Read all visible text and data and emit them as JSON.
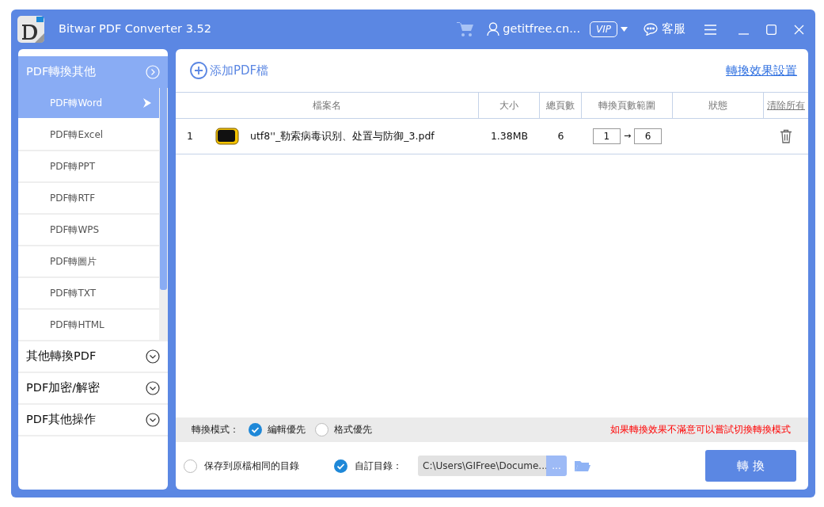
{
  "window": {
    "title": "Bitwar PDF Converter 3.52",
    "account": "getitfree.cn...",
    "vip_badge": "VIP",
    "support": "客服"
  },
  "sidebar": {
    "groups": [
      {
        "label": "PDF轉換其他",
        "expanded": true,
        "items": [
          {
            "label": "PDF轉Word",
            "selected": true
          },
          {
            "label": "PDF轉Excel",
            "selected": false
          },
          {
            "label": "PDF轉PPT",
            "selected": false
          },
          {
            "label": "PDF轉RTF",
            "selected": false
          },
          {
            "label": "PDF轉WPS",
            "selected": false
          },
          {
            "label": "PDF轉圖片",
            "selected": false
          },
          {
            "label": "PDF轉TXT",
            "selected": false
          },
          {
            "label": "PDF轉HTML",
            "selected": false
          }
        ]
      },
      {
        "label": "其他轉換PDF",
        "expanded": false
      },
      {
        "label": "PDF加密/解密",
        "expanded": false
      },
      {
        "label": "PDF其他操作",
        "expanded": false
      }
    ]
  },
  "toolbar": {
    "add_button": "添加PDF檔",
    "settings_link": "轉換效果設置"
  },
  "table": {
    "columns": [
      "檔案名",
      "大小",
      "總頁數",
      "轉換頁數範圍",
      "狀態"
    ],
    "clear_all": "清除所有",
    "rows": [
      {
        "index": "1",
        "file_name": "utf8''_勒索病毒识别、处置与防御_3.pdf",
        "size": "1.38MB",
        "pages": "6",
        "range_from": "1",
        "range_arrow": "→",
        "range_to": "6"
      }
    ]
  },
  "mode_bar": {
    "label": "轉換模式：",
    "options": [
      {
        "label": "編輯優先",
        "selected": true
      },
      {
        "label": "格式優先",
        "selected": false
      }
    ],
    "hint": "如果轉換效果不滿意可以嘗試切換轉換模式"
  },
  "output": {
    "options": [
      {
        "label": "保存到原檔相同的目錄",
        "selected": false
      },
      {
        "label": "自訂目錄：",
        "selected": true
      }
    ],
    "path": "C:\\Users\\GIFree\\Docume...",
    "browse_button": "...",
    "convert_button": "轉 換"
  }
}
